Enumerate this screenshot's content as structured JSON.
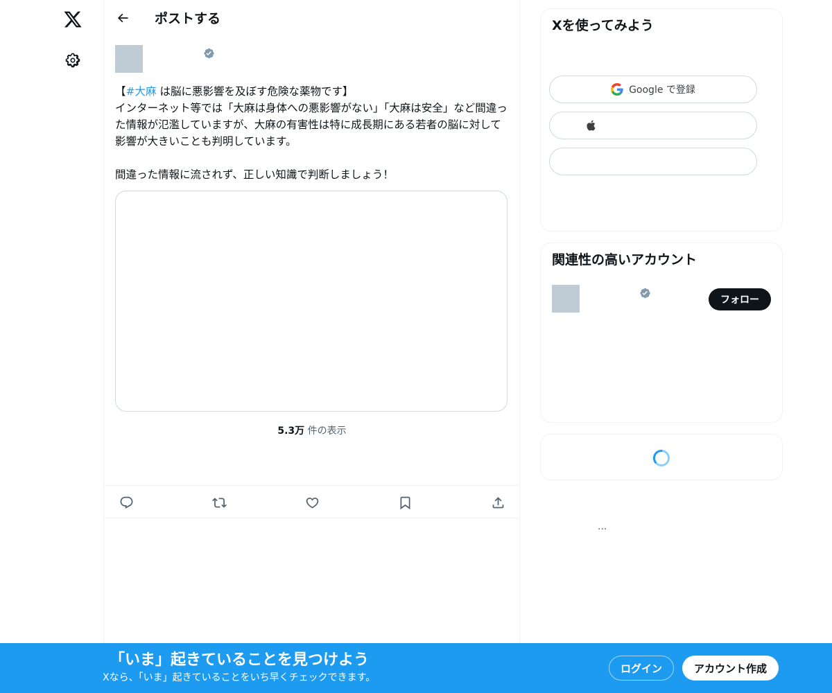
{
  "nav": {
    "logo_icon": "x-logo-icon",
    "settings_icon": "gear-icon"
  },
  "header": {
    "back_icon": "arrow-left-icon",
    "title": "ポストする"
  },
  "post": {
    "verified_icon": "verified-badge-icon",
    "text_open_bracket": "【",
    "hashtag": "#大麻",
    "text_first_line_rest": " は脳に悪影響を及ぼす危険な薬物です】",
    "text_body": "インターネット等では「大麻は身体への悪影響がない」「大麻は安全」など間違った情報が氾濫していますが、大麻の有害性は特に成長期にある若者の脳に対して影響が大きいことも判明しています。\n\n間違った情報に流されず、正しい知識で判断しましょう！",
    "views_count": "5.3万",
    "views_label": " 件の表示"
  },
  "actions": {
    "reply_icon": "reply-icon",
    "repost_icon": "repost-icon",
    "like_icon": "heart-icon",
    "bookmark_icon": "bookmark-icon",
    "share_icon": "share-icon"
  },
  "signup_card": {
    "title": "Xを使ってみよう",
    "google_label": "Google で登録",
    "apple_icon": "apple-icon"
  },
  "related_card": {
    "title": "関連性の高いアカウント",
    "follow_label": "フォロー"
  },
  "more": "...",
  "banner": {
    "title": "「いま」起きていることを見つけよう",
    "subtitle": "Xなら、「いま」起きていることをいち早くチェックできます。",
    "login_label": "ログイン",
    "signup_label": "アカウント作成"
  },
  "colors": {
    "accent": "#1d9bf0",
    "text": "#0f1419",
    "muted": "#536471",
    "border": "#eff3f4"
  }
}
